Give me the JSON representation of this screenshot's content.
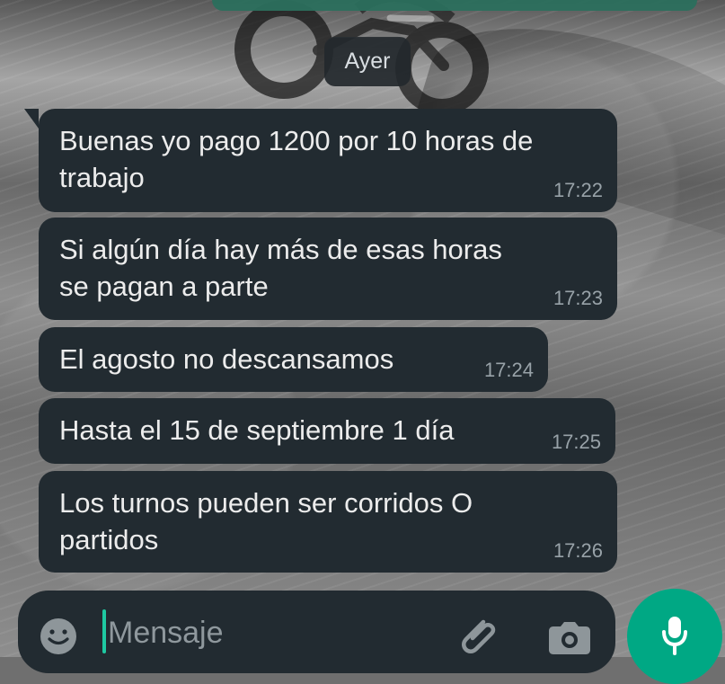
{
  "chat": {
    "date_separator": "Ayer",
    "messages": [
      {
        "text": "Buenas yo pago 1200 por 10 horas de\ntrabajo",
        "time": "17:22"
      },
      {
        "text": "Si algún día hay más de esas horas\nse pagan a parte",
        "time": "17:23"
      },
      {
        "text": "El agosto no descansamos",
        "time": "17:24"
      },
      {
        "text": "Hasta el 15 de septiembre 1 día",
        "time": "17:25"
      },
      {
        "text": "Los turnos pueden ser corridos   O\npartidos",
        "time": "17:26"
      }
    ]
  },
  "composer": {
    "placeholder": "Mensaje",
    "icons": {
      "emoji": "smile-icon",
      "attach": "paperclip-icon",
      "camera": "camera-icon",
      "mic": "microphone-icon"
    }
  },
  "colors": {
    "message_bubble": "#222b31",
    "accent": "#00a884",
    "text_primary": "#ececec",
    "text_secondary": "#98a2a8"
  }
}
